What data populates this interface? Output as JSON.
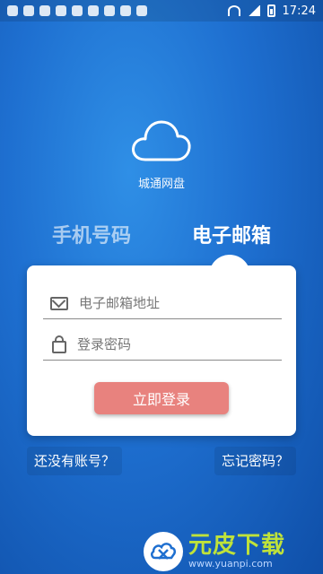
{
  "status_bar": {
    "time": "17:24"
  },
  "logo": {
    "title": "城通网盘"
  },
  "tabs": {
    "phone": "手机号码",
    "email": "电子邮箱"
  },
  "form": {
    "email_placeholder": "电子邮箱地址",
    "password_placeholder": "登录密码",
    "login_label": "立即登录"
  },
  "links": {
    "register": "还没有账号？",
    "forgot": "忘记密码？"
  },
  "watermark": {
    "brand": "元皮下载",
    "url": "www.yuanpi.com"
  },
  "colors": {
    "accent_button": "#e8827e",
    "background": "#1e6fd0"
  }
}
